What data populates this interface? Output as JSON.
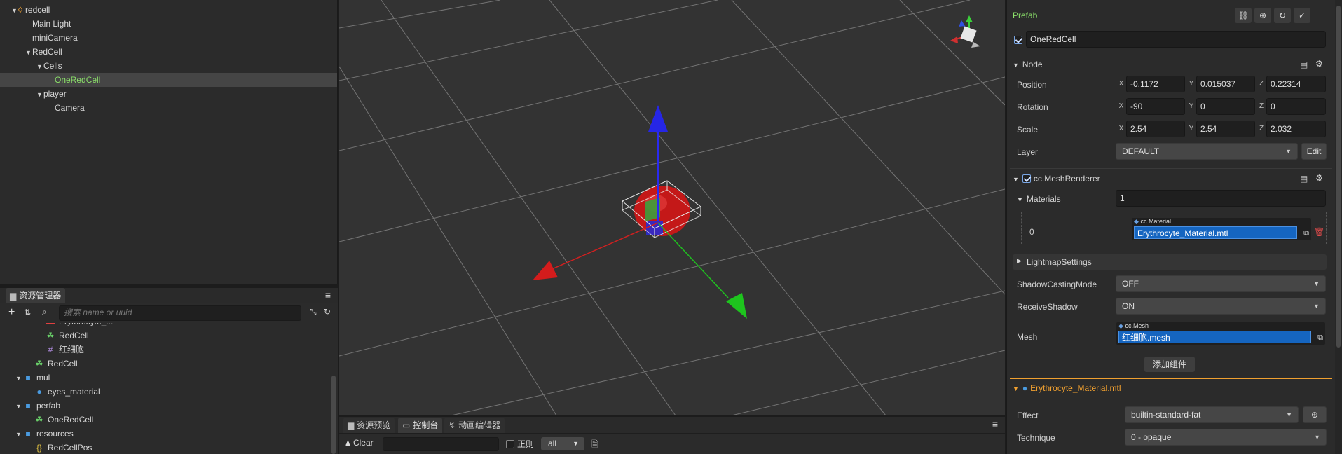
{
  "hierarchy": {
    "items": [
      {
        "label": "redcell",
        "depth": 0,
        "arrow": "▼",
        "icon": "fire-icon",
        "selected": false
      },
      {
        "label": "Main Light",
        "depth": 1,
        "arrow": "",
        "selected": false
      },
      {
        "label": "miniCamera",
        "depth": 1,
        "arrow": "",
        "selected": false
      },
      {
        "label": "RedCell",
        "depth": 1,
        "arrow": "▼",
        "selected": false
      },
      {
        "label": "Cells",
        "depth": 2,
        "arrow": "▼",
        "selected": false
      },
      {
        "label": "OneRedCell",
        "depth": 3,
        "arrow": "",
        "selected": true
      },
      {
        "label": "player",
        "depth": 2,
        "arrow": "▼",
        "selected": false
      },
      {
        "label": "Camera",
        "depth": 3,
        "arrow": "",
        "selected": false
      }
    ]
  },
  "assets": {
    "tab_label": "资源管理器",
    "search_placeholder": "搜索 name or uuid",
    "items": [
      {
        "label": "Erythrocyte_...",
        "depth": 2,
        "arrow": "",
        "icon": "material-icon",
        "icon_color": "#e04040",
        "icon_char": "▬"
      },
      {
        "label": "RedCell",
        "depth": 2,
        "arrow": "",
        "icon": "prefab-icon",
        "icon_color": "#6ad16a",
        "icon_char": "☘"
      },
      {
        "label": "红细胞",
        "depth": 2,
        "arrow": "",
        "icon": "mesh-icon",
        "icon_color": "#b08be0",
        "icon_char": "#"
      },
      {
        "label": "RedCell",
        "depth": 1,
        "arrow": "",
        "icon": "prefab-icon",
        "icon_color": "#6ad16a",
        "icon_char": "☘"
      },
      {
        "label": "mul",
        "depth": 0,
        "arrow": "▼",
        "icon": "folder-icon",
        "icon_color": "#4a9be0",
        "icon_char": "■"
      },
      {
        "label": "eyes_material",
        "depth": 1,
        "arrow": "",
        "icon": "material-icon",
        "icon_color": "#4a9be0",
        "icon_char": "●"
      },
      {
        "label": "perfab",
        "depth": 0,
        "arrow": "▼",
        "icon": "folder-icon",
        "icon_color": "#4a9be0",
        "icon_char": "■"
      },
      {
        "label": "OneRedCell",
        "depth": 1,
        "arrow": "",
        "icon": "prefab-icon",
        "icon_color": "#6ad16a",
        "icon_char": "☘"
      },
      {
        "label": "resources",
        "depth": 0,
        "arrow": "▼",
        "icon": "folder-icon",
        "icon_color": "#4a9be0",
        "icon_char": "■"
      },
      {
        "label": "RedCellPos",
        "depth": 1,
        "arrow": "",
        "icon": "json-icon",
        "icon_color": "#e0c040",
        "icon_char": "{}"
      }
    ]
  },
  "console": {
    "tabs": [
      "资源预览",
      "控制台",
      "动画编辑器"
    ],
    "clear_label": "Clear",
    "regex_label": "正则",
    "level_value": "all"
  },
  "inspector": {
    "prefab_label": "Prefab",
    "node_name": "OneRedCell",
    "node_section": "Node",
    "position": {
      "label": "Position",
      "x": "-0.1172",
      "y": "0.015037",
      "z": "0.22314"
    },
    "rotation": {
      "label": "Rotation",
      "x": "-90",
      "y": "0",
      "z": "0"
    },
    "scale": {
      "label": "Scale",
      "x": "2.54",
      "y": "2.54",
      "z": "2.032"
    },
    "layer": {
      "label": "Layer",
      "value": "DEFAULT",
      "edit_label": "Edit"
    },
    "mesh_renderer": "cc.MeshRenderer",
    "materials": {
      "label": "Materials",
      "count": "1",
      "index": "0",
      "type": "cc.Material",
      "value": "Erythrocyte_Material.mtl"
    },
    "lightmap": "LightmapSettings",
    "shadow_casting": {
      "label": "ShadowCastingMode",
      "value": "OFF"
    },
    "receive_shadow": {
      "label": "ReceiveShadow",
      "value": "ON"
    },
    "mesh": {
      "label": "Mesh",
      "type": "cc.Mesh",
      "value": "红细胞.mesh"
    },
    "add_component": "添加组件",
    "material_section": "Erythrocyte_Material.mtl",
    "effect": {
      "label": "Effect",
      "value": "builtin-standard-fat"
    },
    "technique": {
      "label": "Technique",
      "value": "0 - opaque"
    }
  },
  "axis_letters": {
    "x": "X",
    "y": "Y",
    "z": "Z"
  },
  "colors": {
    "accent_green": "#8be06a",
    "accent_orange": "#f0a030",
    "selection_blue": "#1565c0"
  }
}
